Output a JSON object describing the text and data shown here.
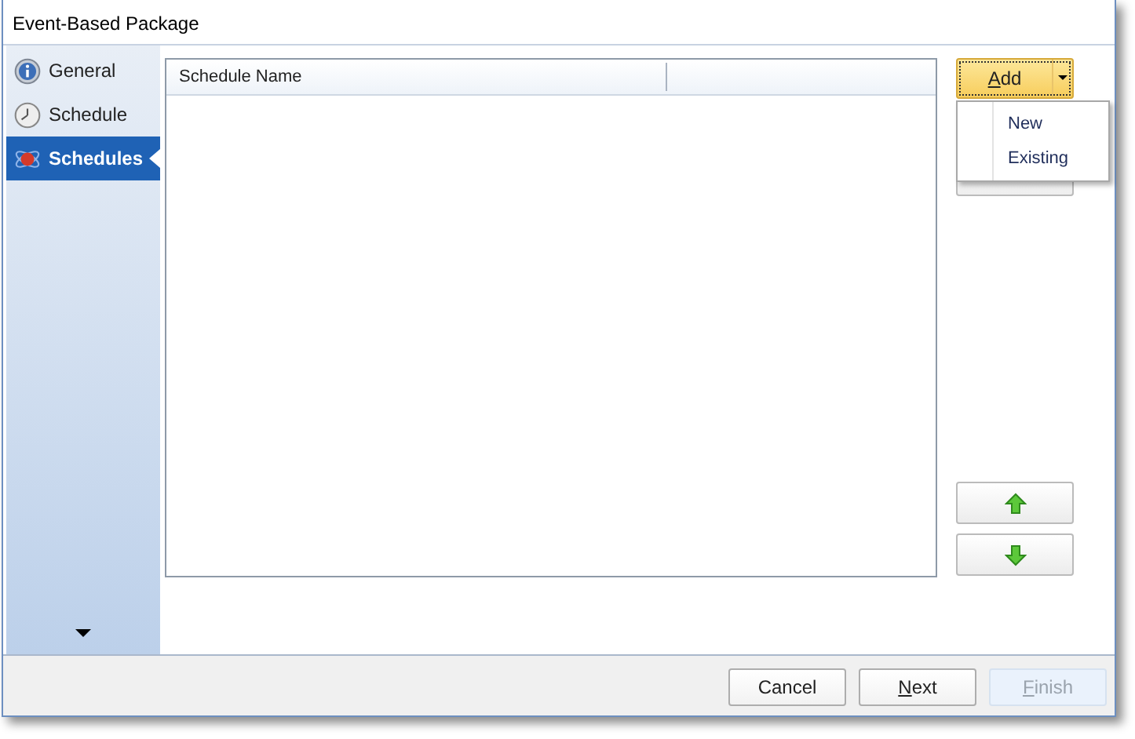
{
  "window": {
    "title": "Event-Based Package"
  },
  "sidebar": {
    "items": [
      {
        "label": "General",
        "kind": "info",
        "selected": false
      },
      {
        "label": "Schedule",
        "kind": "clock",
        "selected": false
      },
      {
        "label": "Schedules",
        "kind": "atom",
        "selected": true
      }
    ]
  },
  "table": {
    "columns": [
      "Schedule Name"
    ]
  },
  "add_button": {
    "label": "Add",
    "mnemonic": true
  },
  "dropdown_menu": {
    "items": [
      "New",
      "Existing"
    ]
  },
  "buttons": [
    {
      "label": "Cancel",
      "mnemonic": false,
      "disabled": false
    },
    {
      "label": "Next",
      "mnemonic": true,
      "disabled": false
    },
    {
      "label": "Finish",
      "mnemonic": true,
      "disabled": true
    }
  ]
}
